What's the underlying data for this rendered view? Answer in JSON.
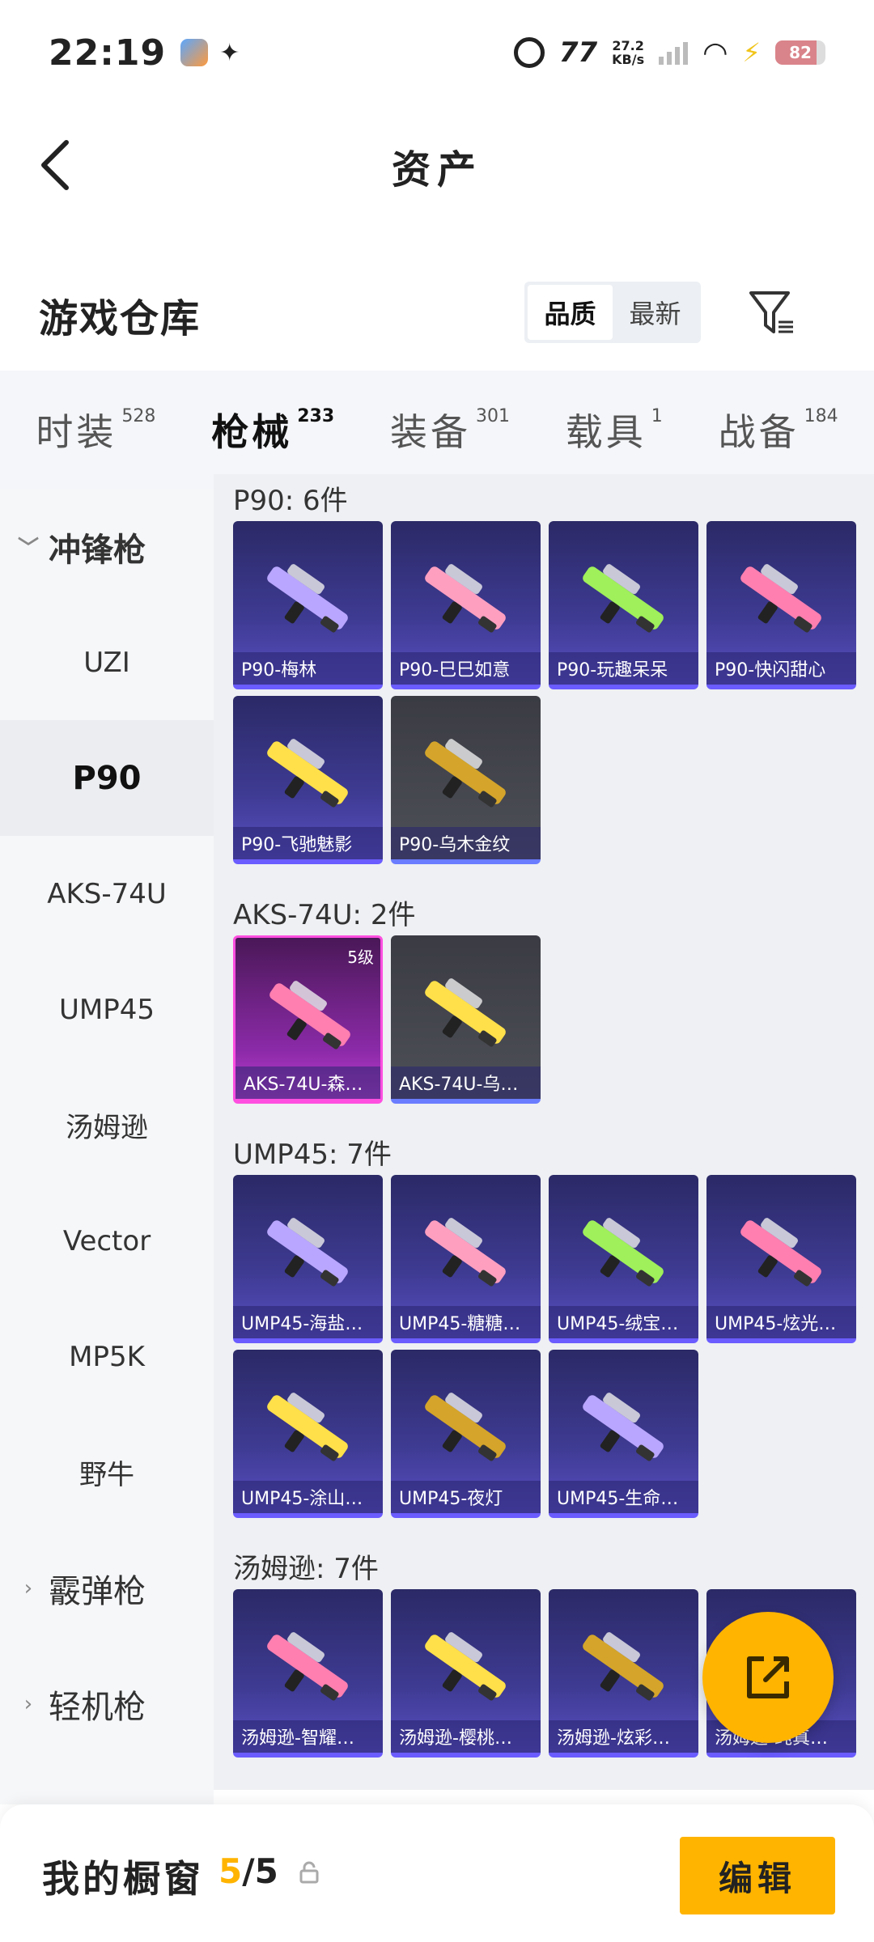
{
  "status_bar": {
    "time": "22:19",
    "net_label": "77",
    "speed_value": "27.2",
    "speed_unit": "KB/s",
    "battery": "82"
  },
  "header": {
    "title": "资产"
  },
  "warehouse": {
    "title": "游戏仓库",
    "sort_options": [
      "品质",
      "最新"
    ],
    "active_sort": "品质"
  },
  "category_tabs": [
    {
      "name": "时装",
      "count": "528"
    },
    {
      "name": "枪械",
      "count": "233"
    },
    {
      "name": "装备",
      "count": "301"
    },
    {
      "name": "载具",
      "count": "1"
    },
    {
      "name": "战备",
      "count": "184"
    }
  ],
  "active_category": "枪械",
  "sidebar": {
    "group_smg": "冲锋枪",
    "items": [
      "UZI",
      "P90",
      "AKS-74U",
      "UMP45",
      "汤姆逊",
      "Vector",
      "MP5K",
      "野牛"
    ],
    "active_item": "P90",
    "group_shotgun": "霰弹枪",
    "group_lmg": "轻机枪"
  },
  "sections": [
    {
      "title": "P90: 6件",
      "items": [
        {
          "label": "P90-梅林",
          "style": "purple"
        },
        {
          "label": "P90-巳巳如意",
          "style": "purple"
        },
        {
          "label": "P90-玩趣呆呆",
          "style": "purple"
        },
        {
          "label": "P90-快闪甜心",
          "style": "purple"
        },
        {
          "label": "P90-飞驰魅影",
          "style": "purple"
        },
        {
          "label": "P90-乌木金纹",
          "style": "gray"
        }
      ]
    },
    {
      "title": "AKS-74U: 2件",
      "items": [
        {
          "label": "AKS-74U-森…",
          "style": "pink",
          "level": "5级"
        },
        {
          "label": "AKS-74U-乌…",
          "style": "gray"
        }
      ]
    },
    {
      "title": "UMP45: 7件",
      "items": [
        {
          "label": "UMP45-海盐…",
          "style": "purple"
        },
        {
          "label": "UMP45-糖糖…",
          "style": "purple"
        },
        {
          "label": "UMP45-绒宝…",
          "style": "purple"
        },
        {
          "label": "UMP45-炫光…",
          "style": "purple"
        },
        {
          "label": "UMP45-涂山…",
          "style": "purple"
        },
        {
          "label": "UMP45-夜灯",
          "style": "purple"
        },
        {
          "label": "UMP45-生命…",
          "style": "purple"
        }
      ]
    },
    {
      "title": "汤姆逊: 7件",
      "items": [
        {
          "label": "汤姆逊-智耀…",
          "style": "purple"
        },
        {
          "label": "汤姆逊-樱桃…",
          "style": "purple"
        },
        {
          "label": "汤姆逊-炫彩…",
          "style": "purple"
        },
        {
          "label": "汤姆逊-纯真…",
          "style": "purple"
        }
      ]
    }
  ],
  "bottom_bar": {
    "window_label": "我的橱窗",
    "count_current": "5",
    "count_total": "/5",
    "edit_label": "编辑"
  },
  "colors": {
    "accent": "#ffb400",
    "card_purple": "#3e3b93",
    "card_gray": "#4e5058",
    "card_pink": "#8b2aa8"
  }
}
